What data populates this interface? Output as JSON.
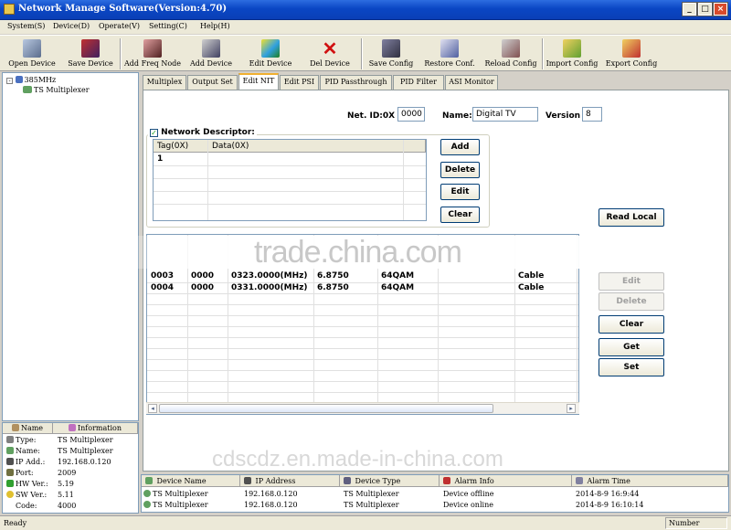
{
  "window": {
    "title": "Network Manage Software(Version:4.70)"
  },
  "menu": [
    "System(S)",
    "Device(D)",
    "Operate(V)",
    "Setting(C)",
    "Help(H)"
  ],
  "toolbar": [
    {
      "label": "Open Device",
      "icon": "open-device-icon"
    },
    {
      "label": "Save Device",
      "icon": "save-device-icon"
    },
    {
      "label": "Add Freq Node",
      "icon": "add-freq-node-icon"
    },
    {
      "label": "Add Device",
      "icon": "add-device-icon"
    },
    {
      "label": "Edit Device",
      "icon": "edit-device-icon"
    },
    {
      "label": "Del Device",
      "icon": "delete-icon"
    },
    {
      "label": "Save Config",
      "icon": "save-config-icon"
    },
    {
      "label": "Restore Conf.",
      "icon": "restore-config-icon"
    },
    {
      "label": "Reload Config",
      "icon": "reload-config-icon"
    },
    {
      "label": "Import Config",
      "icon": "import-config-icon"
    },
    {
      "label": "Export Config",
      "icon": "export-config-icon"
    }
  ],
  "tree": {
    "root": "385MHz",
    "child": "TS Multiplexer"
  },
  "info": {
    "headers": [
      "Name",
      "Information"
    ],
    "rows": [
      {
        "key": "Type:",
        "value": "TS Multiplexer"
      },
      {
        "key": "Name:",
        "value": "TS Multiplexer"
      },
      {
        "key": "IP Add.:",
        "value": "192.168.0.120"
      },
      {
        "key": "Port:",
        "value": "2009"
      },
      {
        "key": "HW Ver.:",
        "value": "5.19"
      },
      {
        "key": "SW Ver.:",
        "value": "5.11"
      },
      {
        "key": "Code:",
        "value": "4000"
      }
    ]
  },
  "tabs": [
    "Multiplex",
    "Output Set",
    "Edit NIT",
    "Edit PSI",
    "PID Passthrough",
    "PID Filter",
    "ASI Monitor"
  ],
  "active_tab": "Edit NIT",
  "nit": {
    "net_id_label": "Net. ID:0X",
    "net_id": "0000",
    "name_label": "Name:",
    "name": "Digital TV",
    "version_label": "Version",
    "version": "8",
    "descriptor_label": "Network Descriptor:",
    "descriptor_checked": true,
    "descriptor_headers": [
      "Tag(0X)",
      "Data(0X)"
    ],
    "descriptor_rows": [
      {
        "tag": "1",
        "data": ""
      }
    ],
    "descriptor_buttons": [
      "Add",
      "Delete",
      "Edit",
      "Clear"
    ],
    "right_buttons": [
      {
        "label": "Read Local",
        "enabled": true
      },
      {
        "label": "Edit",
        "enabled": false
      },
      {
        "label": "Delete",
        "enabled": false
      },
      {
        "label": "Clear",
        "enabled": true
      },
      {
        "label": "Get",
        "enabled": true
      },
      {
        "label": "Set",
        "enabled": true
      }
    ],
    "transport_rows": [
      {
        "id": "0003",
        "onid": "0000",
        "freq": "0323.0000(MHz)",
        "symrate": "6.8750",
        "mod": "64QAM",
        "type": "Cable"
      },
      {
        "id": "0004",
        "onid": "0000",
        "freq": "0331.0000(MHz)",
        "symrate": "6.8750",
        "mod": "64QAM",
        "type": "Cable"
      }
    ]
  },
  "log": {
    "headers": [
      "Device Name",
      "IP Address",
      "Device Type",
      "Alarm Info",
      "Alarm Time"
    ],
    "rows": [
      {
        "name": "TS Multiplexer",
        "ip": "192.168.0.120",
        "type": "TS Multiplexer",
        "alarm": "Device offline",
        "time": "2014-8-9 16:9:44"
      },
      {
        "name": "TS Multiplexer",
        "ip": "192.168.0.120",
        "type": "TS Multiplexer",
        "alarm": "Device online",
        "time": "2014-8-9 16:10:14"
      }
    ]
  },
  "status": {
    "left": "Ready",
    "right": "Number"
  },
  "watermarks": [
    "trade.china.com",
    "cdscdz.en.made-in-china.com"
  ],
  "colors": {
    "titlebar": "#0a46c4",
    "panel_bg": "#ece9d8",
    "tab_accent": "#f0b030"
  }
}
